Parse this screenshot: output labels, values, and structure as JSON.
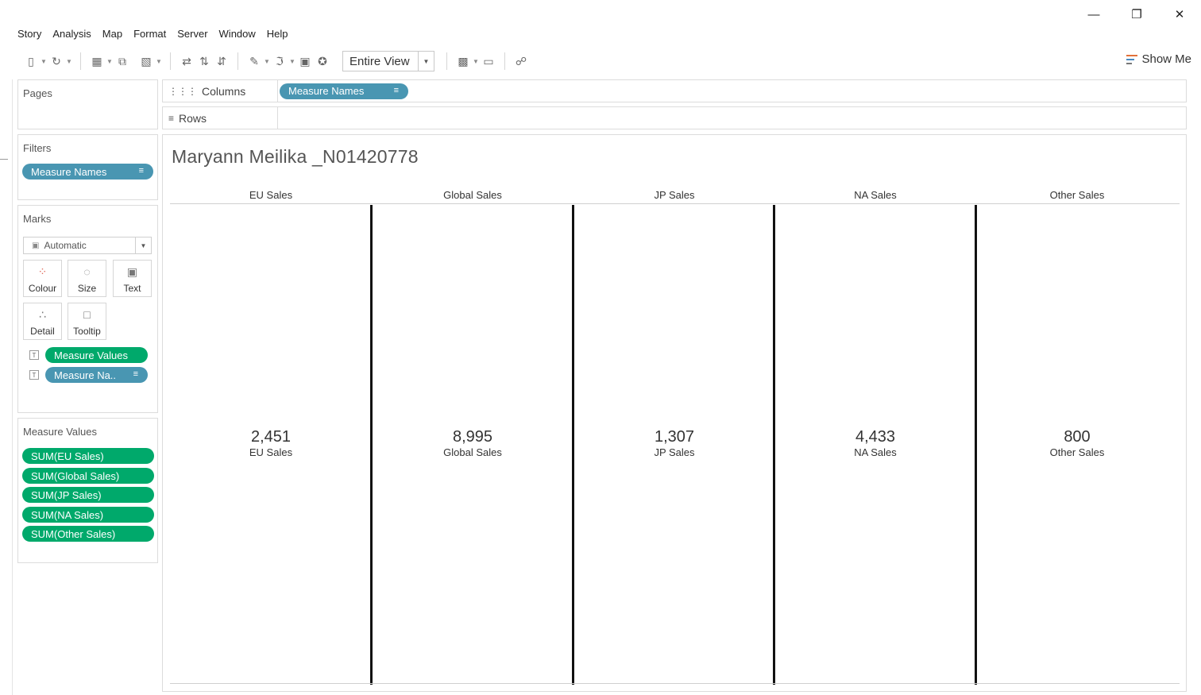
{
  "window": {
    "minimize_icon": "minimize-icon",
    "restore_icon": "restore-icon",
    "close_icon": "close-icon"
  },
  "menu": [
    "Story",
    "Analysis",
    "Map",
    "Format",
    "Server",
    "Window",
    "Help"
  ],
  "toolbar": {
    "view_select": "Entire View",
    "show_me": "Show Me"
  },
  "pages": {
    "title": "Pages"
  },
  "filters": {
    "title": "Filters",
    "pill": "Measure Names"
  },
  "marks": {
    "title": "Marks",
    "mark_type": "Automatic",
    "buttons": [
      "Colour",
      "Size",
      "Text",
      "Detail",
      "Tooltip"
    ],
    "fields": [
      "Measure Values",
      "Measure Na.."
    ]
  },
  "measure_values": {
    "title": "Measure Values",
    "items": [
      "SUM(EU Sales)",
      "SUM(Global Sales)",
      "SUM(JP Sales)",
      "SUM(NA Sales)",
      "SUM(Other Sales)"
    ]
  },
  "shelves": {
    "columns_label": "Columns",
    "columns_pill": "Measure Names",
    "rows_label": "Rows"
  },
  "viz": {
    "title": "Maryann Meilika _N01420778",
    "columns": [
      {
        "header": "EU Sales",
        "value": "2,451",
        "label": "EU Sales"
      },
      {
        "header": "Global Sales",
        "value": "8,995",
        "label": "Global Sales"
      },
      {
        "header": "JP Sales",
        "value": "1,307",
        "label": "JP Sales"
      },
      {
        "header": "NA Sales",
        "value": "4,433",
        "label": "NA Sales"
      },
      {
        "header": "Other Sales",
        "value": "800",
        "label": "Other Sales"
      }
    ]
  },
  "colors": {
    "dimension_pill": "#4996b2",
    "measure_pill": "#00a96b"
  }
}
